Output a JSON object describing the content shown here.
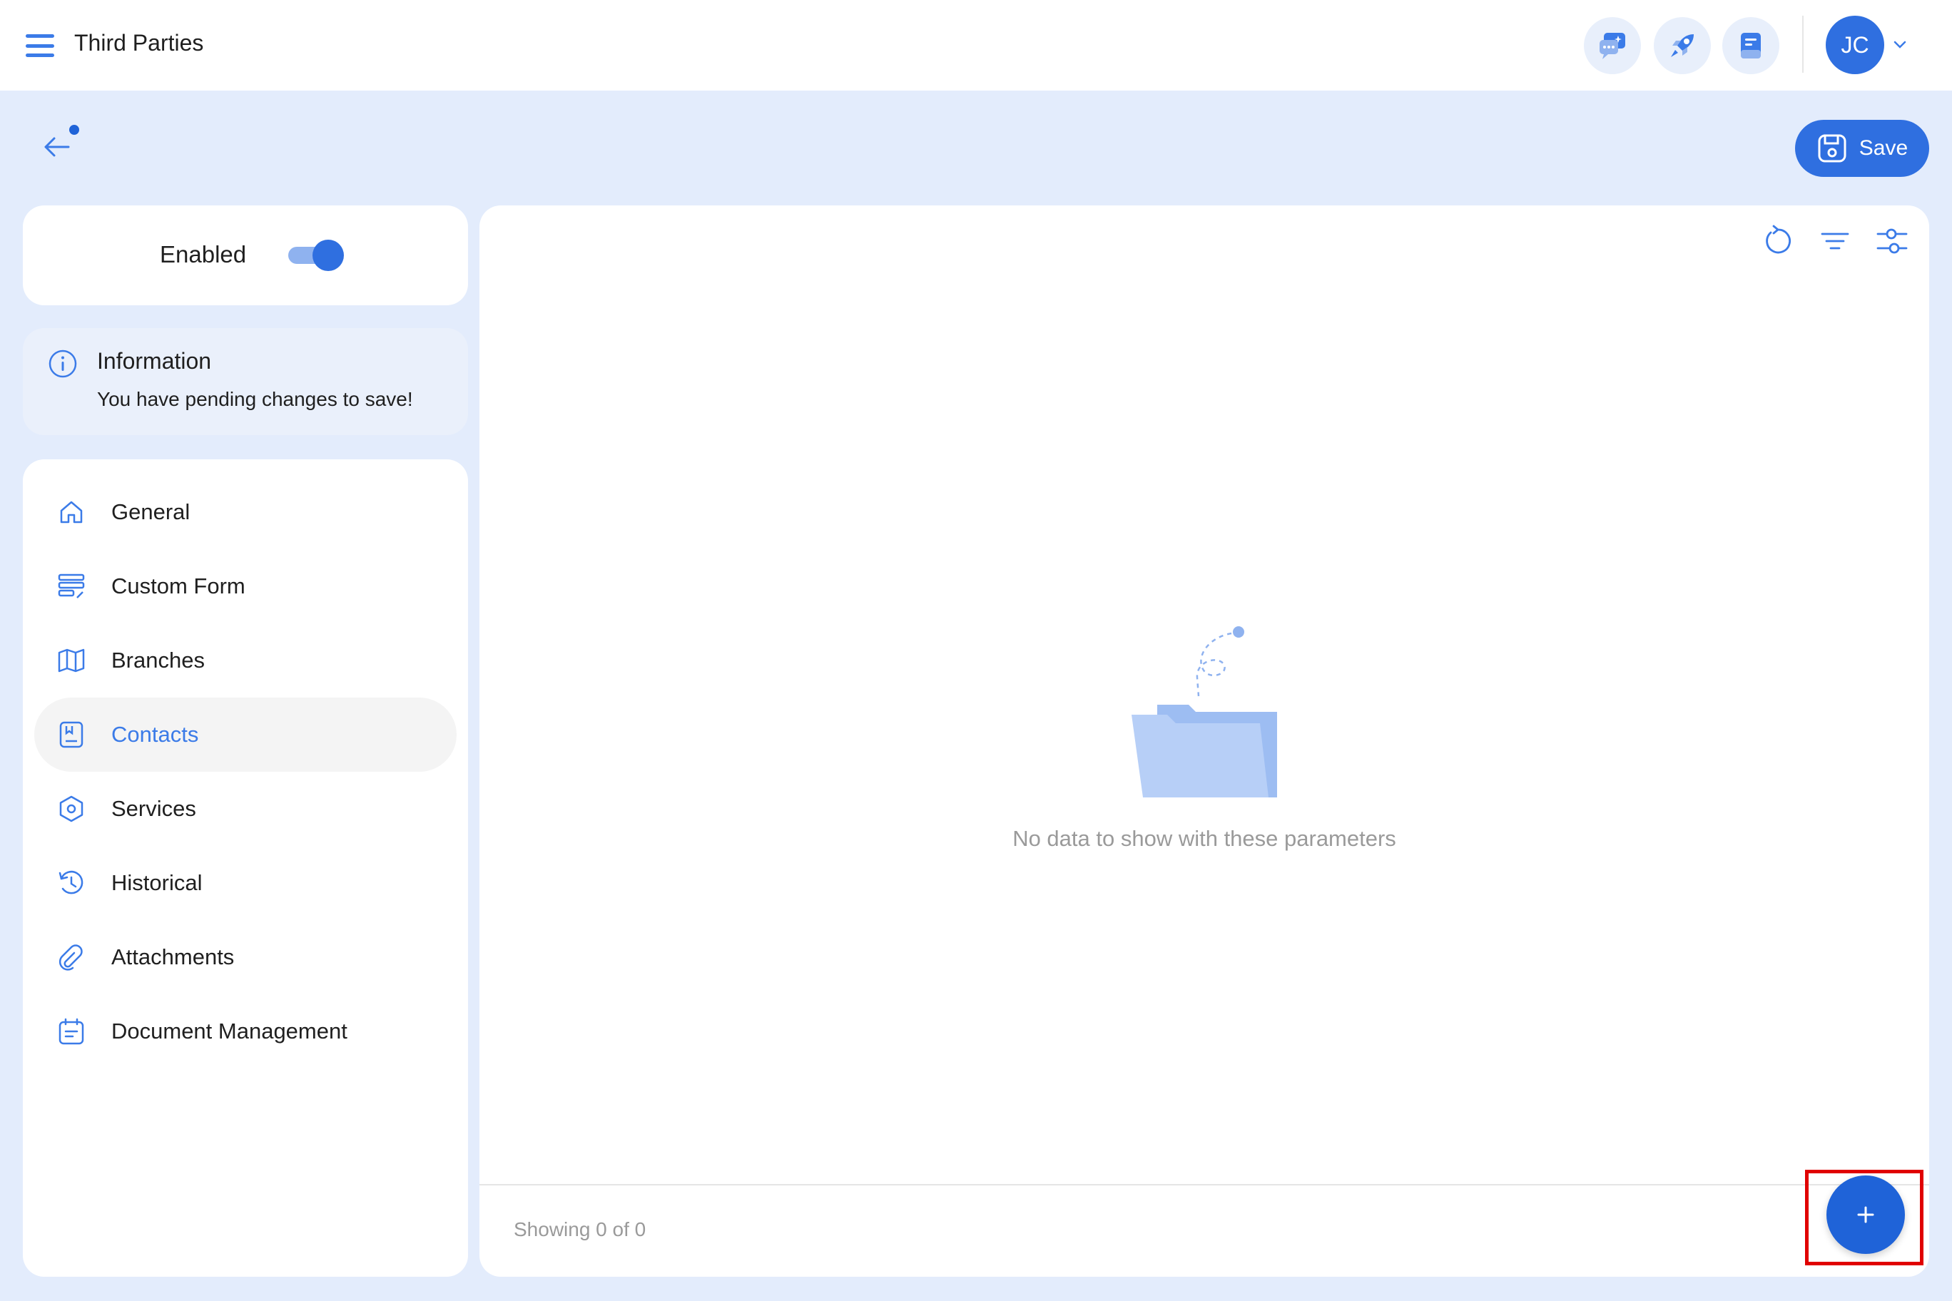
{
  "header": {
    "title": "Third Parties",
    "user_initials": "JC",
    "icons": [
      "chat-ai-icon",
      "rocket-icon",
      "notes-icon"
    ]
  },
  "toolbar": {
    "save_label": "Save"
  },
  "status": {
    "enabled_label": "Enabled",
    "enabled": true
  },
  "info": {
    "title": "Information",
    "message": "You have pending changes to save!"
  },
  "sidebar": {
    "items": [
      {
        "label": "General",
        "icon": "home-icon"
      },
      {
        "label": "Custom Form",
        "icon": "form-icon"
      },
      {
        "label": "Branches",
        "icon": "map-icon"
      },
      {
        "label": "Contacts",
        "icon": "contacts-icon",
        "active": true
      },
      {
        "label": "Services",
        "icon": "hexagon-icon"
      },
      {
        "label": "Historical",
        "icon": "history-icon"
      },
      {
        "label": "Attachments",
        "icon": "attachment-icon"
      },
      {
        "label": "Document Management",
        "icon": "calendar-doc-icon"
      }
    ]
  },
  "main": {
    "empty_message": "No data to show with these parameters",
    "showing_text": "Showing 0 of 0"
  },
  "colors": {
    "accent": "#2f6fe0",
    "background": "#e3ecfc",
    "highlight": "#e00000"
  }
}
